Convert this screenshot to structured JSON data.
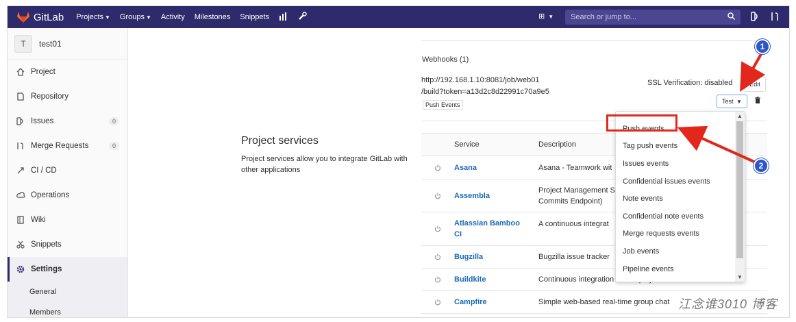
{
  "app": {
    "name": "GitLab"
  },
  "nav": {
    "items": [
      "Projects",
      "Groups",
      "Activity",
      "Milestones",
      "Snippets"
    ]
  },
  "search": {
    "placeholder": "Search or jump to..."
  },
  "sidebar": {
    "project_initial": "T",
    "project_name": "test01",
    "items": [
      {
        "label": "Project",
        "icon": "home-icon"
      },
      {
        "label": "Repository",
        "icon": "file-icon"
      },
      {
        "label": "Issues",
        "icon": "issues-icon",
        "count": "0"
      },
      {
        "label": "Merge Requests",
        "icon": "merge-request-icon",
        "count": "0"
      },
      {
        "label": "CI / CD",
        "icon": "rocket-icon"
      },
      {
        "label": "Operations",
        "icon": "cloud-icon"
      },
      {
        "label": "Wiki",
        "icon": "book-icon"
      },
      {
        "label": "Snippets",
        "icon": "scissors-icon"
      },
      {
        "label": "Settings",
        "icon": "gear-icon"
      }
    ],
    "settings_sub": [
      "General",
      "Members"
    ]
  },
  "services": {
    "title": "Project services",
    "description": "Project services allow you to integrate GitLab with other applications"
  },
  "webhooks": {
    "title": "Webhooks (1)",
    "url_line1": "http://192.168.1.10:8081/job/web01",
    "url_line2": "/build?token=a13d2c8d22991c70a9e5",
    "tag": "Push Events",
    "ssl": "SSL Verification: disabled",
    "edit_label": "Edit",
    "test_label": "Test"
  },
  "table": {
    "headers": [
      "Service",
      "Description"
    ],
    "rows": [
      {
        "service": "Asana",
        "description": "Asana - Teamwork wit"
      },
      {
        "service": "Assembla",
        "description": "Project Management S",
        "description2": "Commits Endpoint)"
      },
      {
        "service": "Atlassian Bamboo",
        "service2": "CI",
        "description": "A continuous integrat"
      },
      {
        "service": "Bugzilla",
        "description": "Bugzilla issue tracker"
      },
      {
        "service": "Buildkite",
        "description": "Continuous integration and deployments"
      },
      {
        "service": "Campfire",
        "description": "Simple web-based real-time group chat"
      }
    ]
  },
  "dropdown": {
    "items": [
      "Push events",
      "Tag push events",
      "Issues events",
      "Confidential issues events",
      "Note events",
      "Confidential note events",
      "Merge requests events",
      "Job events",
      "Pipeline events"
    ]
  },
  "annotations": {
    "num1": "1",
    "num2": "2"
  },
  "watermark": "江念谁3010 博客"
}
